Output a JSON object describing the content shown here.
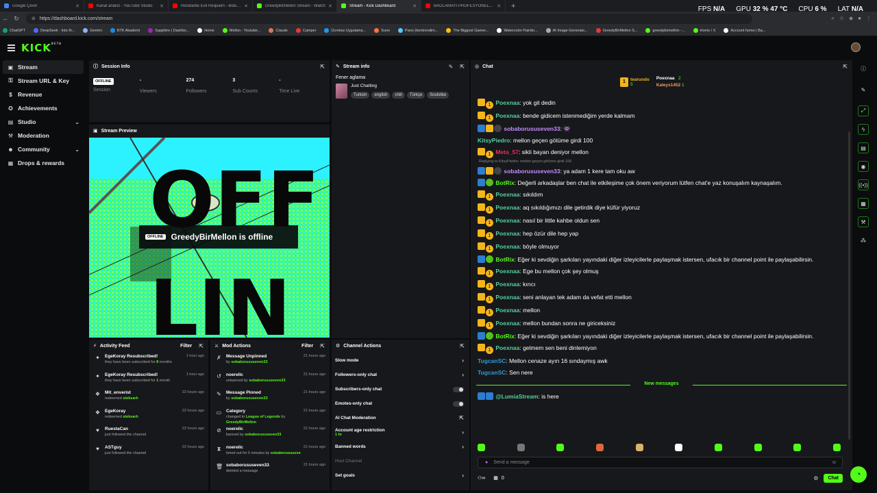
{
  "browser": {
    "tabs": [
      {
        "title": "Google Çeviri",
        "color": "#4285f4"
      },
      {
        "title": "Kanal analizi - YouTube Studio",
        "color": "#ff0000"
      },
      {
        "title": "Residante Evil Requiem - Bölüm 3",
        "color": "#ff0000"
      },
      {
        "title": "GreedyBirMellon Stream - Watch",
        "color": "#53fc18"
      },
      {
        "title": "Stream - Kick Dashboard",
        "color": "#53fc18",
        "active": true
      },
      {
        "title": "BAĞLAMAYI PROFESYONEL ÇALMA",
        "color": "#ff0000"
      }
    ],
    "new_tab": "+",
    "hud": {
      "fps_label": "FPS",
      "fps": "N/A",
      "gpu_label": "GPU",
      "gpu": "32 % 47 °C",
      "cpu_label": "CPU",
      "cpu": "6 %",
      "lat_label": "LAT",
      "lat": "N/A"
    },
    "url": "https://dashboard.kick.com/stream",
    "bookmarks": [
      "ChatGPT",
      "DeepSeek - Into th...",
      "Gemini",
      "BTK Akademi",
      "Sapphire | Dashbo...",
      "Home",
      "Mellon - Youtube...",
      "Claude",
      "Camper",
      "Ücretsiz Uygulama...",
      "Suno",
      "Pano (bentrendim...",
      "The Biggest Gamer...",
      "Watercolor Paintin...",
      "AI Image Generato...",
      "GreedyBirMellon S...",
      "greedybirmellon -...",
      "Home / X",
      "Account home | Ba..."
    ]
  },
  "app": {
    "logo": "KICK",
    "logo_sup": "BETA"
  },
  "sidebar": [
    {
      "label": "Stream",
      "icon": "video-icon",
      "glyph": "▣",
      "active": true
    },
    {
      "label": "Stream URL & Key",
      "icon": "key-icon",
      "glyph": "⚿"
    },
    {
      "label": "Revenue",
      "icon": "dollar-icon",
      "glyph": "$"
    },
    {
      "label": "Achievements",
      "icon": "trophy-icon",
      "glyph": "✪"
    },
    {
      "label": "Studio",
      "icon": "studio-icon",
      "glyph": "▤",
      "expand": true
    },
    {
      "label": "Moderation",
      "icon": "gavel-icon",
      "glyph": "⚒"
    },
    {
      "label": "Community",
      "icon": "community-icon",
      "glyph": "☻",
      "expand": true
    },
    {
      "label": "Drops & rewards",
      "icon": "gift-icon",
      "glyph": "▦"
    }
  ],
  "session": {
    "title": "Session Info",
    "badge": "OFFLINE",
    "stats": [
      {
        "value": "",
        "label": "Session"
      },
      {
        "value": "-",
        "label": "Viewers"
      },
      {
        "value": "274",
        "label": "Followers"
      },
      {
        "value": "3",
        "label": "Sub Counts"
      },
      {
        "value": "-",
        "label": "Time Live"
      }
    ]
  },
  "stream_info": {
    "title": "Stream info",
    "stream_title": "Fener aglama",
    "category": "Just Chatting",
    "tags": [
      "Turkish",
      "english",
      "chill",
      "Türkçe",
      "Soulslike"
    ]
  },
  "preview": {
    "title": "Stream Preview",
    "badge": "OFFLINE",
    "text": "GreedyBirMellon is offline",
    "big_letters_1": "OFF",
    "big_letters_2": "LIN"
  },
  "activity": {
    "title": "Activity Feed",
    "filter": "Filter",
    "items": [
      {
        "icon": "star-icon",
        "glyph": "✦",
        "title": "EgeKoray Resubscribed!",
        "sub_pre": "they have been subscribed for ",
        "sub_hl": "8",
        "sub_post": " months",
        "time": "1 hour ago"
      },
      {
        "icon": "star-icon",
        "glyph": "✦",
        "title": "EgeKoray Resubscribed!",
        "sub_pre": "they have been subscribed for ",
        "sub_hl": "1",
        "sub_post": " month",
        "time": "1 hour ago"
      },
      {
        "icon": "reward-icon",
        "glyph": "❖",
        "title": "Mit_enverist",
        "sub_pre": "redeemed ",
        "sub_hl": "steksarlı",
        "sub_post": "",
        "time": "22 hours ago"
      },
      {
        "icon": "reward-icon",
        "glyph": "❖",
        "title": "EgeKoray",
        "sub_pre": "redeemed ",
        "sub_hl": "steksarlı",
        "sub_post": "",
        "time": "22 hours ago"
      },
      {
        "icon": "heart-icon",
        "glyph": "♥",
        "title": "RuestaCan",
        "sub_pre": "just followed the channel",
        "sub_hl": "",
        "sub_post": "",
        "time": "22 hours ago"
      },
      {
        "icon": "heart-icon",
        "glyph": "♥",
        "title": "ASTguy",
        "sub_pre": "just followed the channel",
        "sub_hl": "",
        "sub_post": "",
        "time": "22 hours ago"
      }
    ]
  },
  "mod": {
    "title": "Mod Actions",
    "filter": "Filter",
    "items": [
      {
        "icon": "unpin-icon",
        "glyph": "✗",
        "title": "Message Unpinned",
        "sub_pre": "by ",
        "sub_hl": "sobaborususeven33",
        "sub_post": "",
        "time": "21 hours ago"
      },
      {
        "icon": "unban-icon",
        "glyph": "↺",
        "title": "noerelic",
        "sub_pre": "unbanned by ",
        "sub_hl": "sobaborususeven33",
        "sub_post": "",
        "time": "21 hours ago"
      },
      {
        "icon": "pin-icon",
        "glyph": "✎",
        "title": "Message Pinned",
        "sub_pre": "by ",
        "sub_hl": "sobaborususeven33",
        "sub_post": "",
        "time": "21 hours ago"
      },
      {
        "icon": "category-icon",
        "glyph": "▭",
        "title": "Category",
        "sub_pre": "changed to ",
        "sub_hl": "League of Legends",
        "sub_post": " by",
        "sub2": "GreedyBirMellon",
        "time": "21 hours ago"
      },
      {
        "icon": "ban-icon",
        "glyph": "⊘",
        "title": "noerelic",
        "sub_pre": "banned by ",
        "sub_hl": "sobaborususeven33",
        "sub_post": "",
        "time": "21 hours ago"
      },
      {
        "icon": "timeout-icon",
        "glyph": "⧗",
        "title": "noerelic",
        "sub_pre": "timed out for 5 minutes by ",
        "sub_hl": "sobaborususeven33",
        "sub_post": "",
        "time": "21 hours ago"
      },
      {
        "icon": "trash-icon",
        "glyph": "🗑",
        "title": "sobaborususeven33",
        "sub_pre": "deleted a message",
        "sub_hl": "",
        "sub_post": "",
        "time": "21 hours ago"
      }
    ]
  },
  "channel_actions": {
    "title": "Channel Actions",
    "items": [
      {
        "label": "Slow mode",
        "kind": "chevron"
      },
      {
        "label": "Followers-only chat",
        "kind": "chevron"
      },
      {
        "label": "Subscribers-only chat",
        "kind": "toggle"
      },
      {
        "label": "Emotes-only chat",
        "kind": "toggle"
      },
      {
        "label": "AI Chat Moderation",
        "kind": "external"
      },
      {
        "label": "Account age restriction",
        "sub": "1 hr",
        "kind": "chevron"
      },
      {
        "label": "Banned words",
        "kind": "chevron"
      },
      {
        "label": "Host Channel",
        "kind": "dim"
      },
      {
        "label": "Set goals",
        "kind": "chevron"
      }
    ]
  },
  "chat": {
    "title": "Chat",
    "leaderboard": [
      {
        "name": "tearundo",
        "count": "5"
      },
      {
        "name": "Poexnaa",
        "count": "2"
      },
      {
        "name": "Kaleys1452",
        "count": "1"
      }
    ],
    "messages": [
      {
        "badges": [
          "crown",
          "one"
        ],
        "user": "Poexnaa",
        "color": "#53d1a1",
        "text": "yok git dedin"
      },
      {
        "badges": [
          "crown",
          "one"
        ],
        "user": "Poexnaa",
        "color": "#53d1a1",
        "text": "bende gidicem istenmediğim yerde kalmam"
      },
      {
        "badges": [
          "bot",
          "crown",
          "gray"
        ],
        "user": "sobaborususeven33",
        "color": "#c58cff",
        "text": "👾"
      },
      {
        "badges": [],
        "user": "KitsyPiedro",
        "color": "#53d1a1",
        "text": "mellon geçen götüme girdi 100"
      },
      {
        "badges": [
          "crown",
          "one"
        ],
        "user": "Meta_57",
        "color": "#e0305f",
        "text": "sikli bayan deniyor mellon"
      },
      {
        "reply": "Replying to KitsyPiedro: mellon geçen götüme girdi 100"
      },
      {
        "badges": [
          "bot",
          "crown",
          "gray"
        ],
        "user": "sobaborususeven33",
        "color": "#c58cff",
        "text": "ya adam 1 kere tam oku aw"
      },
      {
        "badges": [
          "bot",
          "ver"
        ],
        "user": "BotRix",
        "color": "#53fc18",
        "text": "Değerli arkadaşlar ben chat ile etkileşime çok önem veriyorum lütfen chat'e yaz konuşalım kaynaşalım."
      },
      {
        "badges": [
          "crown",
          "one"
        ],
        "user": "Poexnaa",
        "color": "#53d1a1",
        "text": "sıkıldım"
      },
      {
        "badges": [
          "crown",
          "one"
        ],
        "user": "Poexnaa",
        "color": "#53d1a1",
        "text": "aq sıkıldığımızı dile getirdik diye küfür yiyoruz"
      },
      {
        "badges": [
          "crown",
          "one"
        ],
        "user": "Poexnaa",
        "color": "#53d1a1",
        "text": "nasıl bir little kahbe oldun sen"
      },
      {
        "badges": [
          "crown",
          "one"
        ],
        "user": "Poexnaa",
        "color": "#53d1a1",
        "text": "hep özür dile hep yap"
      },
      {
        "badges": [
          "crown",
          "one"
        ],
        "user": "Poexnaa",
        "color": "#53d1a1",
        "text": "böyle olmuyor"
      },
      {
        "badges": [
          "bot",
          "ver"
        ],
        "user": "BotRix",
        "color": "#53fc18",
        "text": "Eğer ki sevdiğin şarkıları yayındaki diğer izleyicilerle paylaşmak istersen, ufacık bir channel point ile paylaşabilirsin."
      },
      {
        "badges": [
          "crown",
          "one"
        ],
        "user": "Poexnaa",
        "color": "#53d1a1",
        "text": "Ege bu mellon çok şey olmuş"
      },
      {
        "badges": [
          "crown",
          "one"
        ],
        "user": "Poexnaa",
        "color": "#53d1a1",
        "text": "kırıcı"
      },
      {
        "badges": [
          "crown",
          "one"
        ],
        "user": "Poexnaa",
        "color": "#53d1a1",
        "text": "seni anlayan tek adam da vefat etti mellon"
      },
      {
        "badges": [
          "crown",
          "one"
        ],
        "user": "Poexnaa",
        "color": "#53d1a1",
        "text": "mellon"
      },
      {
        "badges": [
          "crown",
          "one"
        ],
        "user": "Poexnaa",
        "color": "#53d1a1",
        "text": "mellon bundan sonra ne giriceksiniz"
      },
      {
        "badges": [
          "bot",
          "ver"
        ],
        "user": "BotRix",
        "color": "#53fc18",
        "text": "Eğer ki sevdiğin şarkıları yayındaki diğer izleyicilerle paylaşmak istersen, ufacık bir channel point ile paylaşabilirsin."
      },
      {
        "badges": [
          "crown",
          "one"
        ],
        "user": "Poexnaa",
        "color": "#53d1a1",
        "text": "gelmem sen beni dinlemiyon"
      },
      {
        "badges": [],
        "user": "TugcanSC",
        "color": "#2d9cdb",
        "text": "Mellon cenaze ayın 16 sındaymış awk"
      },
      {
        "badges": [],
        "user": "TugcanSC",
        "color": "#2d9cdb",
        "text": "Sen nere"
      }
    ],
    "new_messages": "New messages",
    "last_message": {
      "badges": [
        "bot",
        "bot"
      ],
      "user": "@LumiaStream",
      "color": "#53d1a1",
      "text": "is here"
    },
    "placeholder": "Send a message",
    "points": "0",
    "send": "Chat"
  },
  "colors": {
    "accent": "#53fc18",
    "panel": "#17181b",
    "bg": "#0b0c0e"
  }
}
